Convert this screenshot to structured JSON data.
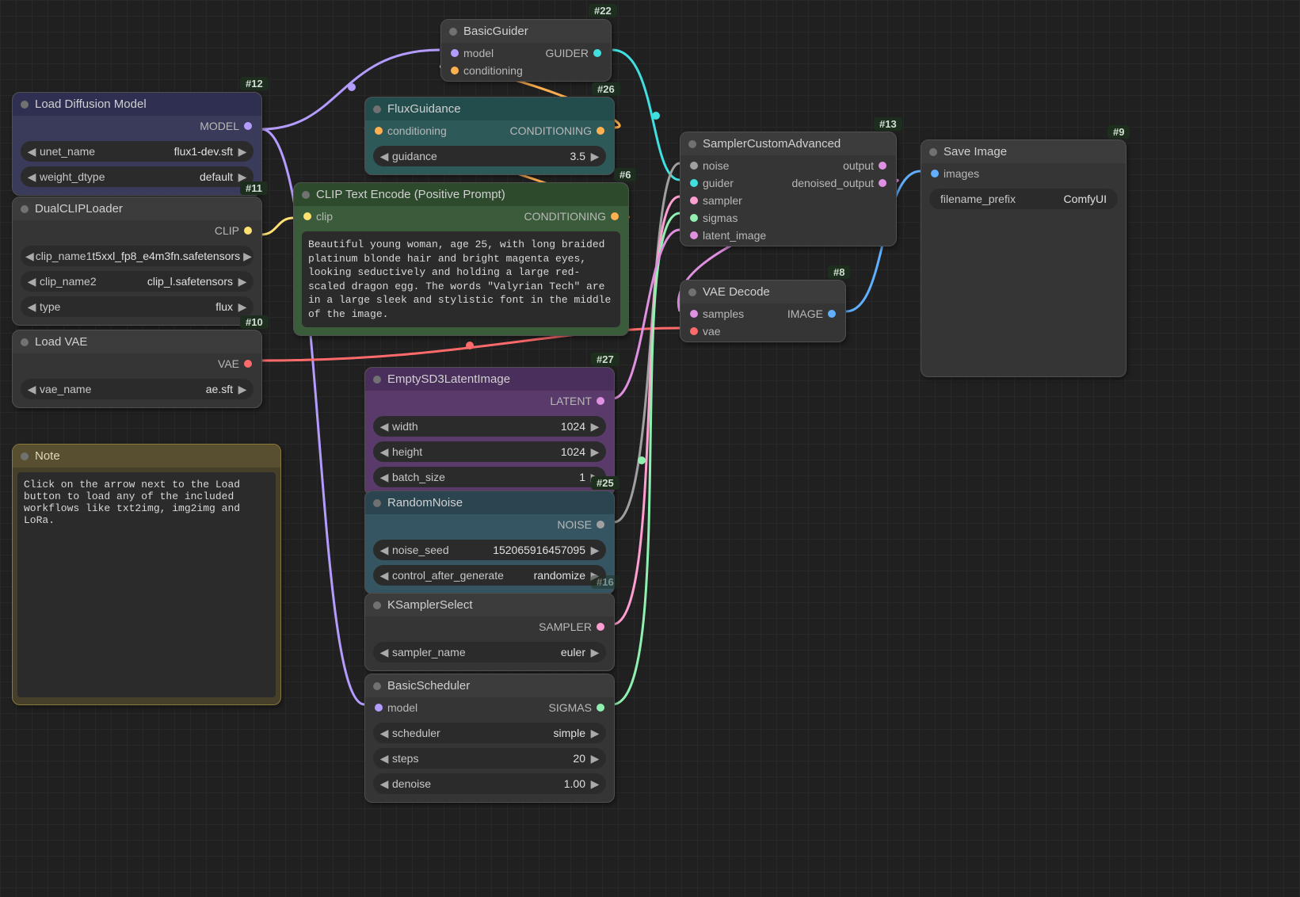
{
  "nodes": {
    "load_diffusion": {
      "id": "#12",
      "title": "Load Diffusion Model",
      "out_model": "MODEL",
      "unet_name_label": "unet_name",
      "unet_name_value": "flux1-dev.sft",
      "weight_dtype_label": "weight_dtype",
      "weight_dtype_value": "default"
    },
    "dual_clip": {
      "id": "#11",
      "title": "DualCLIPLoader",
      "out_clip": "CLIP",
      "clip_name1_label": "clip_name1",
      "clip_name1_value": "t5xxl_fp8_e4m3fn.safetensors",
      "clip_name2_label": "clip_name2",
      "clip_name2_value": "clip_l.safetensors",
      "type_label": "type",
      "type_value": "flux"
    },
    "load_vae": {
      "id": "#10",
      "title": "Load VAE",
      "out_vae": "VAE",
      "vae_name_label": "vae_name",
      "vae_name_value": "ae.sft"
    },
    "note": {
      "title": "Note",
      "body": "Click on the arrow next to the Load button to load any of the included workflows like txt2img, img2img and LoRa."
    },
    "basic_guider": {
      "id": "#22",
      "title": "BasicGuider",
      "in_model": "model",
      "in_conditioning": "conditioning",
      "out_guider": "GUIDER"
    },
    "flux_guidance": {
      "id": "#26",
      "title": "FluxGuidance",
      "in_conditioning": "conditioning",
      "out_conditioning": "CONDITIONING",
      "guidance_label": "guidance",
      "guidance_value": "3.5"
    },
    "clip_text": {
      "id": "#6",
      "title": "CLIP Text Encode (Positive Prompt)",
      "in_clip": "clip",
      "out_conditioning": "CONDITIONING",
      "text": "Beautiful young woman, age 25, with long braided platinum blonde hair and bright magenta eyes, looking seductively and holding a large red-scaled dragon egg. The words \"Valyrian Tech\" are in a large sleek and stylistic font in the middle of the image."
    },
    "empty_latent": {
      "id": "#27",
      "title": "EmptySD3LatentImage",
      "out_latent": "LATENT",
      "width_label": "width",
      "width_value": "1024",
      "height_label": "height",
      "height_value": "1024",
      "batch_label": "batch_size",
      "batch_value": "1"
    },
    "random_noise": {
      "id": "#25",
      "title": "RandomNoise",
      "out_noise": "NOISE",
      "seed_label": "noise_seed",
      "seed_value": "152065916457095",
      "control_label": "control_after_generate",
      "control_value": "randomize"
    },
    "ksampler_select": {
      "id_hidden": "#16",
      "title": "KSamplerSelect",
      "out_sampler": "SAMPLER",
      "sampler_name_label": "sampler_name",
      "sampler_name_value": "euler"
    },
    "basic_scheduler": {
      "title": "BasicScheduler",
      "in_model": "model",
      "out_sigmas": "SIGMAS",
      "scheduler_label": "scheduler",
      "scheduler_value": "simple",
      "steps_label": "steps",
      "steps_value": "20",
      "denoise_label": "denoise",
      "denoise_value": "1.00"
    },
    "sampler_custom": {
      "id": "#13",
      "title": "SamplerCustomAdvanced",
      "in_noise": "noise",
      "in_guider": "guider",
      "in_sampler": "sampler",
      "in_sigmas": "sigmas",
      "in_latent": "latent_image",
      "out_output": "output",
      "out_denoised": "denoised_output"
    },
    "vae_decode": {
      "id": "#8",
      "title": "VAE Decode",
      "in_samples": "samples",
      "in_vae": "vae",
      "out_image": "IMAGE"
    },
    "save_image": {
      "id": "#9",
      "title": "Save Image",
      "in_images": "images",
      "prefix_label": "filename_prefix",
      "prefix_value": "ComfyUI"
    }
  },
  "colors": {
    "model": "#b49cff",
    "clip": "#ffe070",
    "vae": "#ff6b6b",
    "conditioning": "#ffb050",
    "guider": "#40e0e0",
    "noise": "#a0a0a0",
    "sampler": "#ff9ed0",
    "sigmas": "#90f0b0",
    "latent": "#e090e0",
    "image": "#60b0ff"
  }
}
